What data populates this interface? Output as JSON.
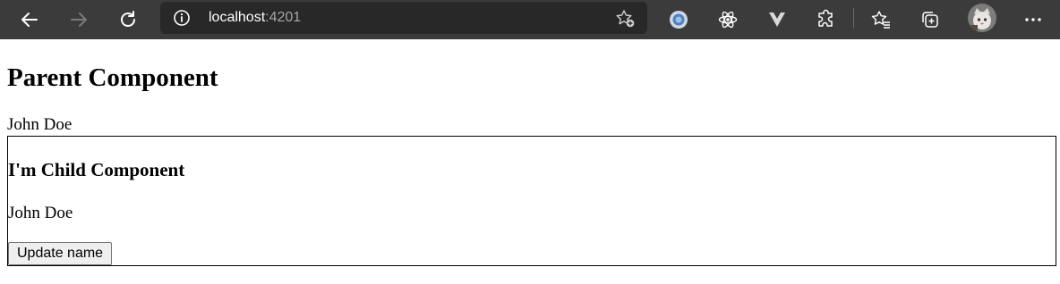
{
  "browser": {
    "address_host": "localhost",
    "address_port": ":4201",
    "icons": {
      "back": "back-arrow-icon",
      "forward": "forward-arrow-icon",
      "refresh": "refresh-icon",
      "info": "info-icon",
      "favorite": "add-favorite-icon",
      "ext_circle": "circle-extension-icon",
      "react": "react-devtools-icon",
      "vue": "vue-devtools-icon",
      "extensions": "puzzle-extensions-icon",
      "favorites": "favorites-icon",
      "collections": "collections-icon",
      "profile": "profile-avatar",
      "more": "more-menu-icon"
    },
    "colors": {
      "toolbar": "#3b3b3b",
      "address_bar": "#282828"
    }
  },
  "page": {
    "parent_title": "Parent Component",
    "parent_name": "John Doe",
    "child": {
      "title": "I'm Child Component",
      "name": "John Doe",
      "button_label": "Update name"
    }
  }
}
